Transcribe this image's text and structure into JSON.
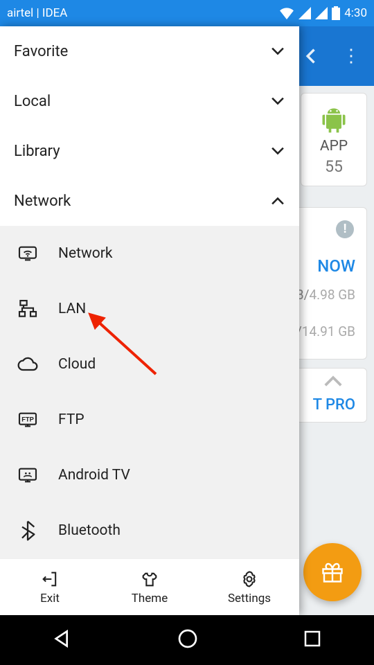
{
  "statusbar": {
    "carrier": "airtel | IDEA",
    "time": "4:30"
  },
  "drawer": {
    "categories": [
      {
        "label": "Favorite",
        "expanded": false
      },
      {
        "label": "Local",
        "expanded": false
      },
      {
        "label": "Library",
        "expanded": false
      },
      {
        "label": "Network",
        "expanded": true
      }
    ],
    "network_items": [
      {
        "label": "Network",
        "icon": "network-display-icon"
      },
      {
        "label": "LAN",
        "icon": "lan-icon"
      },
      {
        "label": "Cloud",
        "icon": "cloud-icon"
      },
      {
        "label": "FTP",
        "icon": "ftp-icon"
      },
      {
        "label": "Android TV",
        "icon": "android-tv-icon"
      },
      {
        "label": "Bluetooth",
        "icon": "bluetooth-icon"
      }
    ],
    "footer": {
      "exit": "Exit",
      "theme": "Theme",
      "settings": "Settings"
    }
  },
  "main": {
    "app_tile": {
      "label": "APP",
      "count": "55"
    },
    "now": "NOW",
    "storage1": {
      "used": "B",
      "sep": "/",
      "total": "4.98 GB"
    },
    "storage2": {
      "used": "",
      "sep": "/",
      "total": "14.91 GB"
    },
    "pro": "T PRO"
  }
}
